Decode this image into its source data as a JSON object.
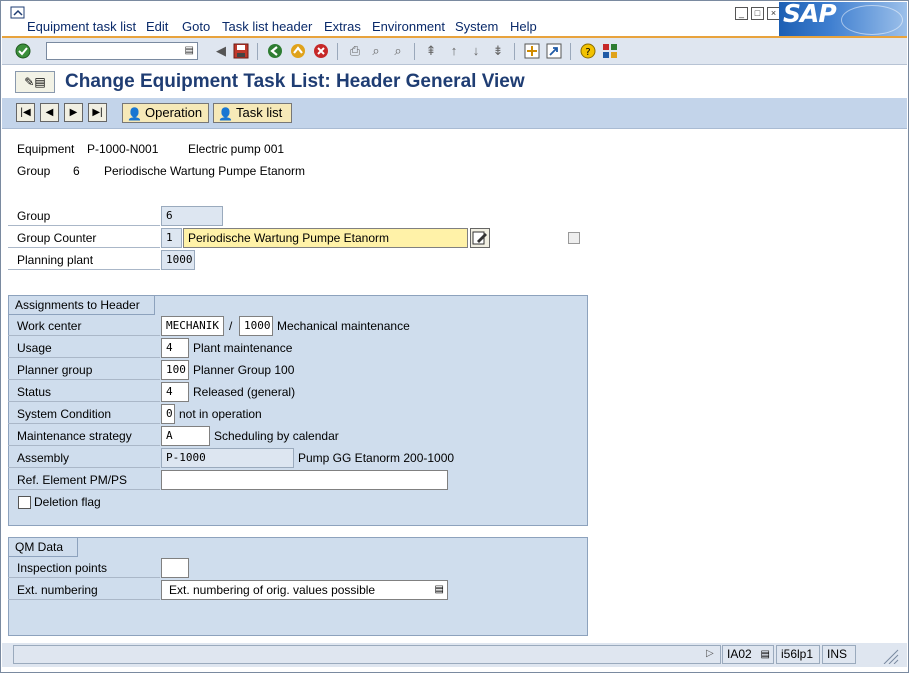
{
  "menu": [
    "Equipment task list",
    "Edit",
    "Goto",
    "Task list header",
    "Extras",
    "Environment",
    "System",
    "Help"
  ],
  "logo": "SAP",
  "title": "Change Equipment Task List: Header General View",
  "toolbar": {
    "command_value": ""
  },
  "app_buttons": {
    "operation": "Operation",
    "task_list": "Task list"
  },
  "header_info": {
    "equipment_label": "Equipment",
    "equipment_value": "P-1000-N001",
    "equipment_desc": "Electric pump 001",
    "group_label": "Group",
    "group_value": "6",
    "group_desc": "Periodische Wartung Pumpe Etanorm"
  },
  "general": {
    "group_label": "Group",
    "group_value": "6",
    "group_counter_label": "Group Counter",
    "group_counter_value": "1",
    "group_counter_desc": "Periodische Wartung Pumpe Etanorm",
    "planning_plant_label": "Planning plant",
    "planning_plant_value": "1000"
  },
  "assignments": {
    "title": "Assignments to Header",
    "work_center_label": "Work center",
    "work_center_value": "MECHANIK",
    "slash": "/",
    "work_center_plant": "1000",
    "work_center_desc": "Mechanical maintenance",
    "usage_label": "Usage",
    "usage_value": "4",
    "usage_desc": "Plant maintenance",
    "planner_group_label": "Planner group",
    "planner_group_value": "100",
    "planner_group_desc": "Planner Group 100",
    "status_label": "Status",
    "status_value": "4",
    "status_desc": "Released (general)",
    "system_condition_label": "System Condition",
    "system_condition_value": "0",
    "system_condition_desc": "not in operation",
    "maint_strategy_label": "Maintenance strategy",
    "maint_strategy_value": "A",
    "maint_strategy_desc": "Scheduling by calendar",
    "assembly_label": "Assembly",
    "assembly_value": "P-1000",
    "assembly_desc": "Pump GG  Etanorm 200-1000",
    "ref_element_label": "Ref. Element PM/PS",
    "ref_element_value": "",
    "deletion_flag_label": "Deletion flag"
  },
  "qm": {
    "title": "QM Data",
    "inspection_points_label": "Inspection points",
    "inspection_points_value": "",
    "ext_numbering_label": "Ext. numbering",
    "ext_numbering_value": "Ext. numbering of orig. values possible"
  },
  "status_bar": {
    "transaction": "IA02",
    "server": "i56lp1",
    "mode": "INS"
  },
  "colors": {
    "title": "#1f3d73",
    "panel": "#cfdded",
    "app_toolbar": "#c3d4ea",
    "highlight": "#fff2a8"
  }
}
